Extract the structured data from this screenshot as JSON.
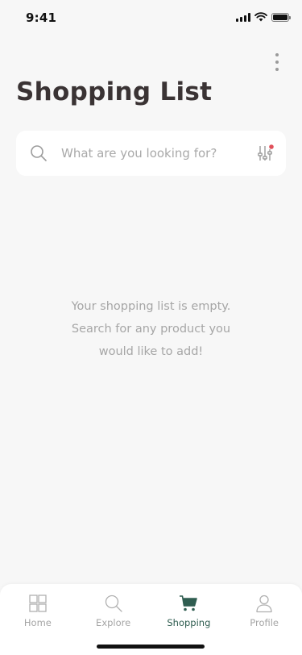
{
  "status_bar": {
    "time": "9:41"
  },
  "header": {
    "title": "Shopping List"
  },
  "search": {
    "placeholder": "What are you looking for?",
    "value": "",
    "filter_has_indicator": true,
    "indicator_color": "#e0505a"
  },
  "empty_state": {
    "lines": [
      "Your shopping list is empty.",
      "Search for any product you",
      "would like to add!"
    ]
  },
  "bottom_nav": {
    "items": [
      {
        "label": "Home",
        "icon": "grid-icon",
        "active": false
      },
      {
        "label": "Explore",
        "icon": "search-icon",
        "active": false
      },
      {
        "label": "Shopping",
        "icon": "cart-icon",
        "active": true
      },
      {
        "label": "Profile",
        "icon": "person-icon",
        "active": false
      }
    ]
  },
  "colors": {
    "background": "#f7f7f7",
    "title": "#3a3334",
    "accent": "#2f5d50",
    "muted": "#a5a5a5"
  }
}
